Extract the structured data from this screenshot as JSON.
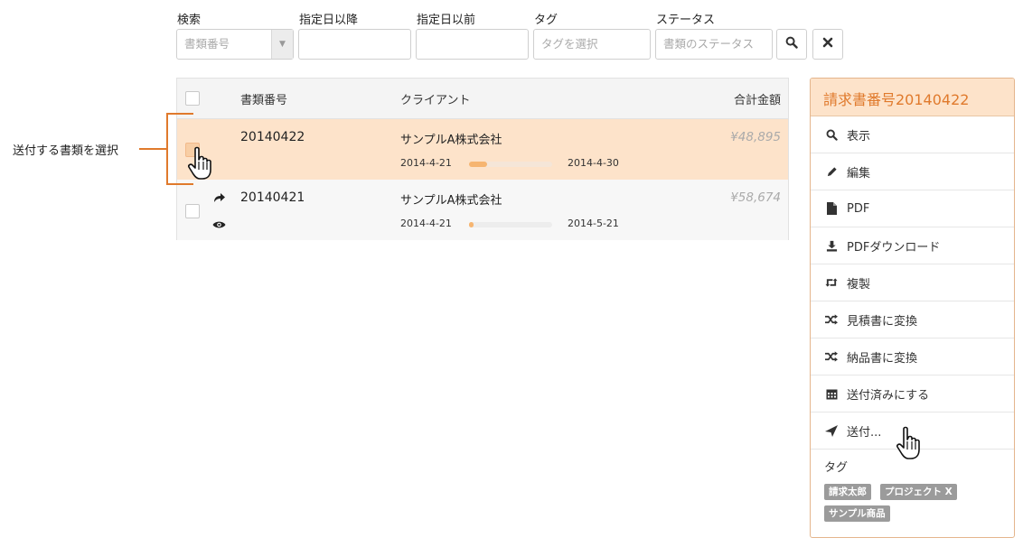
{
  "filters": {
    "search": {
      "label": "検索",
      "placeholder": "書類番号"
    },
    "date_from": {
      "label": "指定日以降",
      "value": ""
    },
    "date_to": {
      "label": "指定日以前",
      "value": ""
    },
    "tag": {
      "label": "タグ",
      "placeholder": "タグを選択"
    },
    "status": {
      "label": "ステータス",
      "placeholder": "書類のステータス"
    }
  },
  "table": {
    "headers": {
      "doc_no": "書類番号",
      "client": "クライアント",
      "total": "合計金額"
    },
    "rows": [
      {
        "doc_no": "20140422",
        "client": "サンプルA株式会社",
        "amount": "¥48,895",
        "start": "2014-4-21",
        "end": "2014-4-30",
        "progress": 0.22
      },
      {
        "doc_no": "20140421",
        "client": "サンプルA株式会社",
        "amount": "¥58,674",
        "start": "2014-4-21",
        "end": "2014-5-21",
        "progress": 0.05
      }
    ]
  },
  "annotation": {
    "text": "送付する書類を選択"
  },
  "panel": {
    "title": "請求書番号20140422",
    "menu": [
      {
        "label": "表示",
        "icon": "search-icon"
      },
      {
        "label": "編集",
        "icon": "pencil-icon"
      },
      {
        "label": "PDF",
        "icon": "file-icon"
      },
      {
        "label": "PDFダウンロード",
        "icon": "download-icon"
      },
      {
        "label": "複製",
        "icon": "retweet-icon"
      },
      {
        "label": "見積書に変換",
        "icon": "shuffle-icon"
      },
      {
        "label": "納品書に変換",
        "icon": "shuffle-icon"
      },
      {
        "label": "送付済みにする",
        "icon": "calendar-icon"
      },
      {
        "label": "送付...",
        "icon": "send-icon"
      }
    ],
    "tags_title": "タグ",
    "tags": [
      "請求太郎",
      "プロジェクト X",
      "サンプル商品"
    ]
  },
  "colors": {
    "accent": "#e07a2c",
    "highlight": "#fde3ca",
    "progress": "#f6b571"
  }
}
